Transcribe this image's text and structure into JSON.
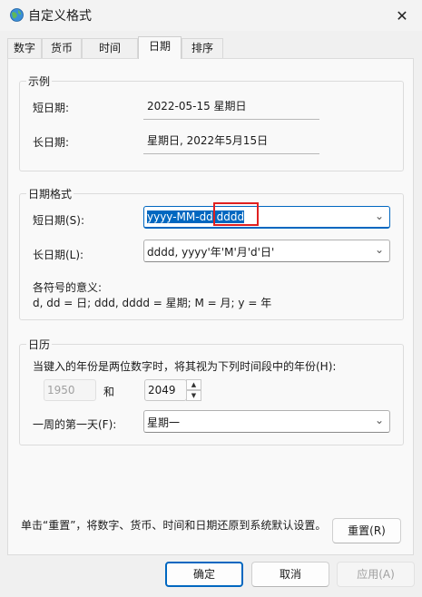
{
  "window": {
    "title": "自定义格式",
    "close_label": "✕"
  },
  "tabs": [
    "数字",
    "货币",
    "时间",
    "日期",
    "排序"
  ],
  "example": {
    "group_title": "示例",
    "short_label": "短日期:",
    "short_value": "2022-05-15 星期日",
    "long_label": "长日期:",
    "long_value": "星期日, 2022年5月15日"
  },
  "date_format": {
    "group_title": "日期格式",
    "short_label": "短日期(S):",
    "short_value_part1": "yyyy-MM-dd",
    "short_value_part2": " dddd",
    "long_label": "长日期(L):",
    "long_value": "dddd, yyyy'年'M'月'd'日'",
    "legend_title": "各符号的意义:",
    "legend_text": "d, dd = 日;  ddd, dddd = 星期;  M = 月;  y = 年"
  },
  "calendar": {
    "group_title": "日历",
    "description": "当键入的年份是两位数字时，将其视为下列时间段中的年份(H):",
    "start_year": "1950",
    "and_label": "和",
    "end_year": "2049",
    "first_day_label": "一周的第一天(F):",
    "first_day_value": "星期一"
  },
  "footer": {
    "reset_text": "单击“重置”，将数字、货币、时间和日期还原到系统默认设置。",
    "reset_button": "重置(R)"
  },
  "buttons": {
    "ok": "确定",
    "cancel": "取消",
    "apply": "应用(A)"
  }
}
